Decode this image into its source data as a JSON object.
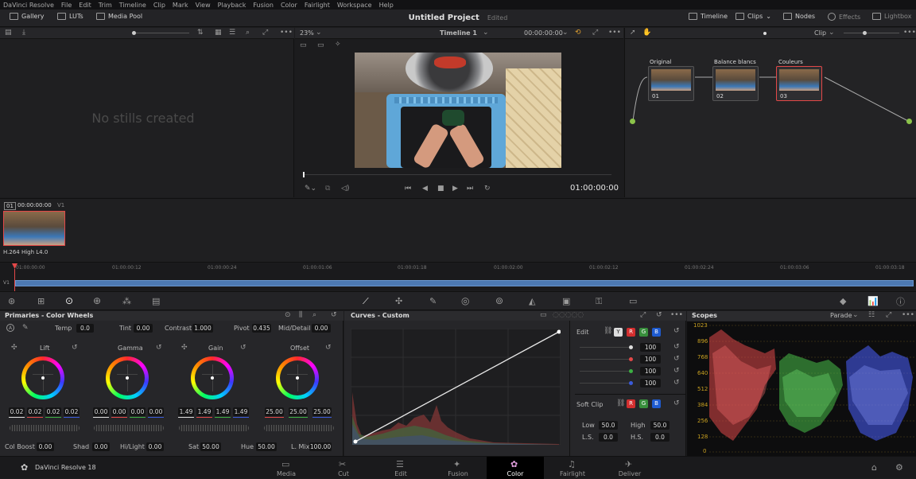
{
  "menubar": {
    "items": [
      "DaVinci Resolve",
      "File",
      "Edit",
      "Trim",
      "Timeline",
      "Clip",
      "Mark",
      "View",
      "Playback",
      "Fusion",
      "Color",
      "Fairlight",
      "Workspace",
      "Help"
    ]
  },
  "topbar": {
    "gallery": "Gallery",
    "luts": "LUTs",
    "media_pool": "Media Pool",
    "project_title": "Untitled Project",
    "project_status": "Edited",
    "timeline": "Timeline",
    "clips": "Clips",
    "nodes": "Nodes",
    "effects": "Effects",
    "lightbox": "Lightbox"
  },
  "gallery": {
    "empty_text": "No stills created"
  },
  "viewer": {
    "zoom": "23%",
    "timeline_name": "Timeline 1",
    "timecode_top": "00:00:00:00",
    "timecode": "01:00:00:00"
  },
  "node_editor": {
    "mode": "Clip",
    "nodes": [
      {
        "title": "Original",
        "label": "01"
      },
      {
        "title": "Balance blancs",
        "label": "02"
      },
      {
        "title": "Couleurs",
        "label": "03"
      }
    ]
  },
  "clip_strip": {
    "clip_number": "01",
    "clip_timecode": "00:00:00:00",
    "track": "V1",
    "codec": "H.264 High L4.0"
  },
  "timeline_ruler": {
    "ticks": [
      "01:00:00:00",
      "01:00:00:12",
      "01:00:00:24",
      "01:00:01:06",
      "01:00:01:18",
      "01:00:02:00",
      "01:00:02:12",
      "01:00:02:24",
      "01:00:03:06",
      "01:00:03:18"
    ],
    "track": "V1"
  },
  "primaries": {
    "title": "Primaries - Color Wheels",
    "temp_label": "Temp",
    "temp": "0.0",
    "tint_label": "Tint",
    "tint": "0.00",
    "contrast_label": "Contrast",
    "contrast": "1.000",
    "pivot_label": "Pivot",
    "pivot": "0.435",
    "middetail_label": "Mid/Detail",
    "middetail": "0.00",
    "wheels": [
      {
        "name": "Lift",
        "values": [
          "0.02",
          "0.02",
          "0.02",
          "0.02"
        ]
      },
      {
        "name": "Gamma",
        "values": [
          "0.00",
          "0.00",
          "0.00",
          "0.00"
        ]
      },
      {
        "name": "Gain",
        "values": [
          "1.49",
          "1.49",
          "1.49",
          "1.49"
        ]
      },
      {
        "name": "Offset",
        "values": [
          "25.00",
          "25.00",
          "25.00"
        ]
      }
    ],
    "colboost_label": "Col Boost",
    "colboost": "0.00",
    "shad_label": "Shad",
    "shad": "0.00",
    "hilight_label": "Hi/Light",
    "hilight": "0.00",
    "sat_label": "Sat",
    "sat": "50.00",
    "hue_label": "Hue",
    "hue": "50.00",
    "lmix_label": "L. Mix",
    "lmix": "100.00"
  },
  "curves": {
    "title": "Curves - Custom",
    "edit_label": "Edit",
    "channel_y": "Y",
    "channel_r": "R",
    "channel_g": "G",
    "channel_b": "B",
    "edit_values": [
      "100",
      "100",
      "100",
      "100"
    ],
    "softclip_label": "Soft Clip",
    "low_label": "Low",
    "low": "50.0",
    "high_label": "High",
    "high": "50.0",
    "ls_label": "L.S.",
    "ls": "0.0",
    "hs_label": "H.S.",
    "hs": "0.0"
  },
  "scopes": {
    "title": "Scopes",
    "mode": "Parade",
    "scale": [
      "1023",
      "896",
      "768",
      "640",
      "512",
      "384",
      "256",
      "128",
      "0"
    ]
  },
  "pages": {
    "app_name": "DaVinci Resolve 18",
    "tabs": [
      "Media",
      "Cut",
      "Edit",
      "Fusion",
      "Color",
      "Fairlight",
      "Deliver"
    ],
    "active": "Color"
  },
  "colors": {
    "accent": "#e34848",
    "active_tab": "#000000",
    "timeline_bar": "#4d79b3"
  }
}
